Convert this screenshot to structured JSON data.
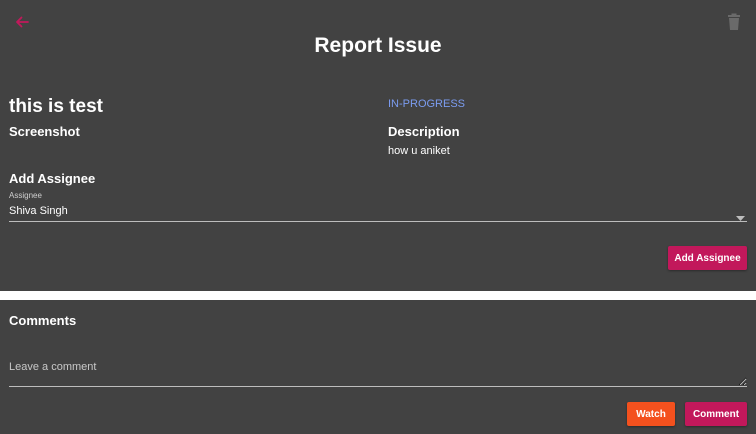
{
  "header": {
    "title": "Report Issue",
    "back_icon": "arrow-left-icon",
    "delete_icon": "trash-icon"
  },
  "issue": {
    "title": "this is test",
    "status": "IN-PROGRESS",
    "screenshot_label": "Screenshot",
    "description_label": "Description",
    "description": "how u aniket"
  },
  "assignee": {
    "section_label": "Add Assignee",
    "field_label": "Assignee",
    "selected": "Shiva Singh",
    "button_label": "Add Assignee"
  },
  "comments": {
    "title": "Comments",
    "placeholder": "Leave a comment",
    "watch_label": "Watch",
    "comment_label": "Comment"
  },
  "colors": {
    "background": "#424242",
    "accent_pink": "#c2185b",
    "accent_orange": "#f4511e",
    "status_blue": "#7b9cf0"
  }
}
